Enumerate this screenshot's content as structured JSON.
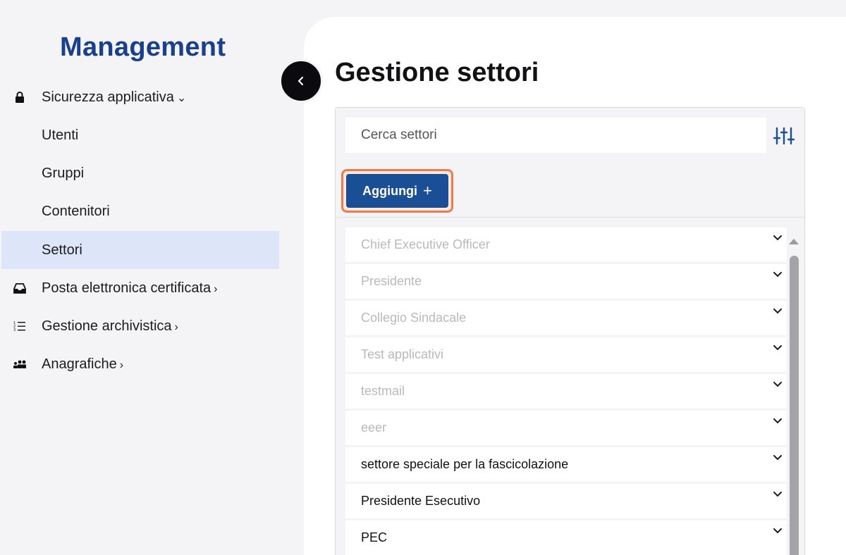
{
  "sidebar": {
    "brand": "Management",
    "items": [
      {
        "label": "Sicurezza applicativa",
        "chevron": "⌄",
        "icon": "lock-icon"
      },
      {
        "label": "Utenti"
      },
      {
        "label": "Gruppi"
      },
      {
        "label": "Contenitori"
      },
      {
        "label": "Settori",
        "active": true
      },
      {
        "label": "Posta elettronica certificata",
        "chevron": "›",
        "icon": "inbox-icon"
      },
      {
        "label": "Gestione archivistica",
        "chevron": "›",
        "icon": "numbered-list-icon"
      },
      {
        "label": "Anagrafiche",
        "chevron": "›",
        "icon": "people-group-icon"
      }
    ]
  },
  "main": {
    "title": "Gestione settori",
    "search": {
      "placeholder": "Cerca settori"
    },
    "add_button": {
      "label": "Aggiungi",
      "icon": "plus-icon"
    },
    "list": [
      {
        "label": "Chief Executive Officer",
        "disabled": true
      },
      {
        "label": "Presidente",
        "disabled": true
      },
      {
        "label": "Collegio Sindacale",
        "disabled": true
      },
      {
        "label": "Test applicativi",
        "disabled": true
      },
      {
        "label": "testmail",
        "disabled": true
      },
      {
        "label": "eeer",
        "disabled": true
      },
      {
        "label": "settore speciale per la fascicolazione",
        "disabled": false
      },
      {
        "label": "Presidente Esecutivo",
        "disabled": false
      },
      {
        "label": "PEC",
        "disabled": false
      }
    ]
  },
  "colors": {
    "brand": "#1a3f8c",
    "primary_button": "#1b4f95",
    "highlight_outline": "#f07a4a",
    "active_nav": "#dde6f8",
    "disabled_text": "#b9b9bd"
  }
}
